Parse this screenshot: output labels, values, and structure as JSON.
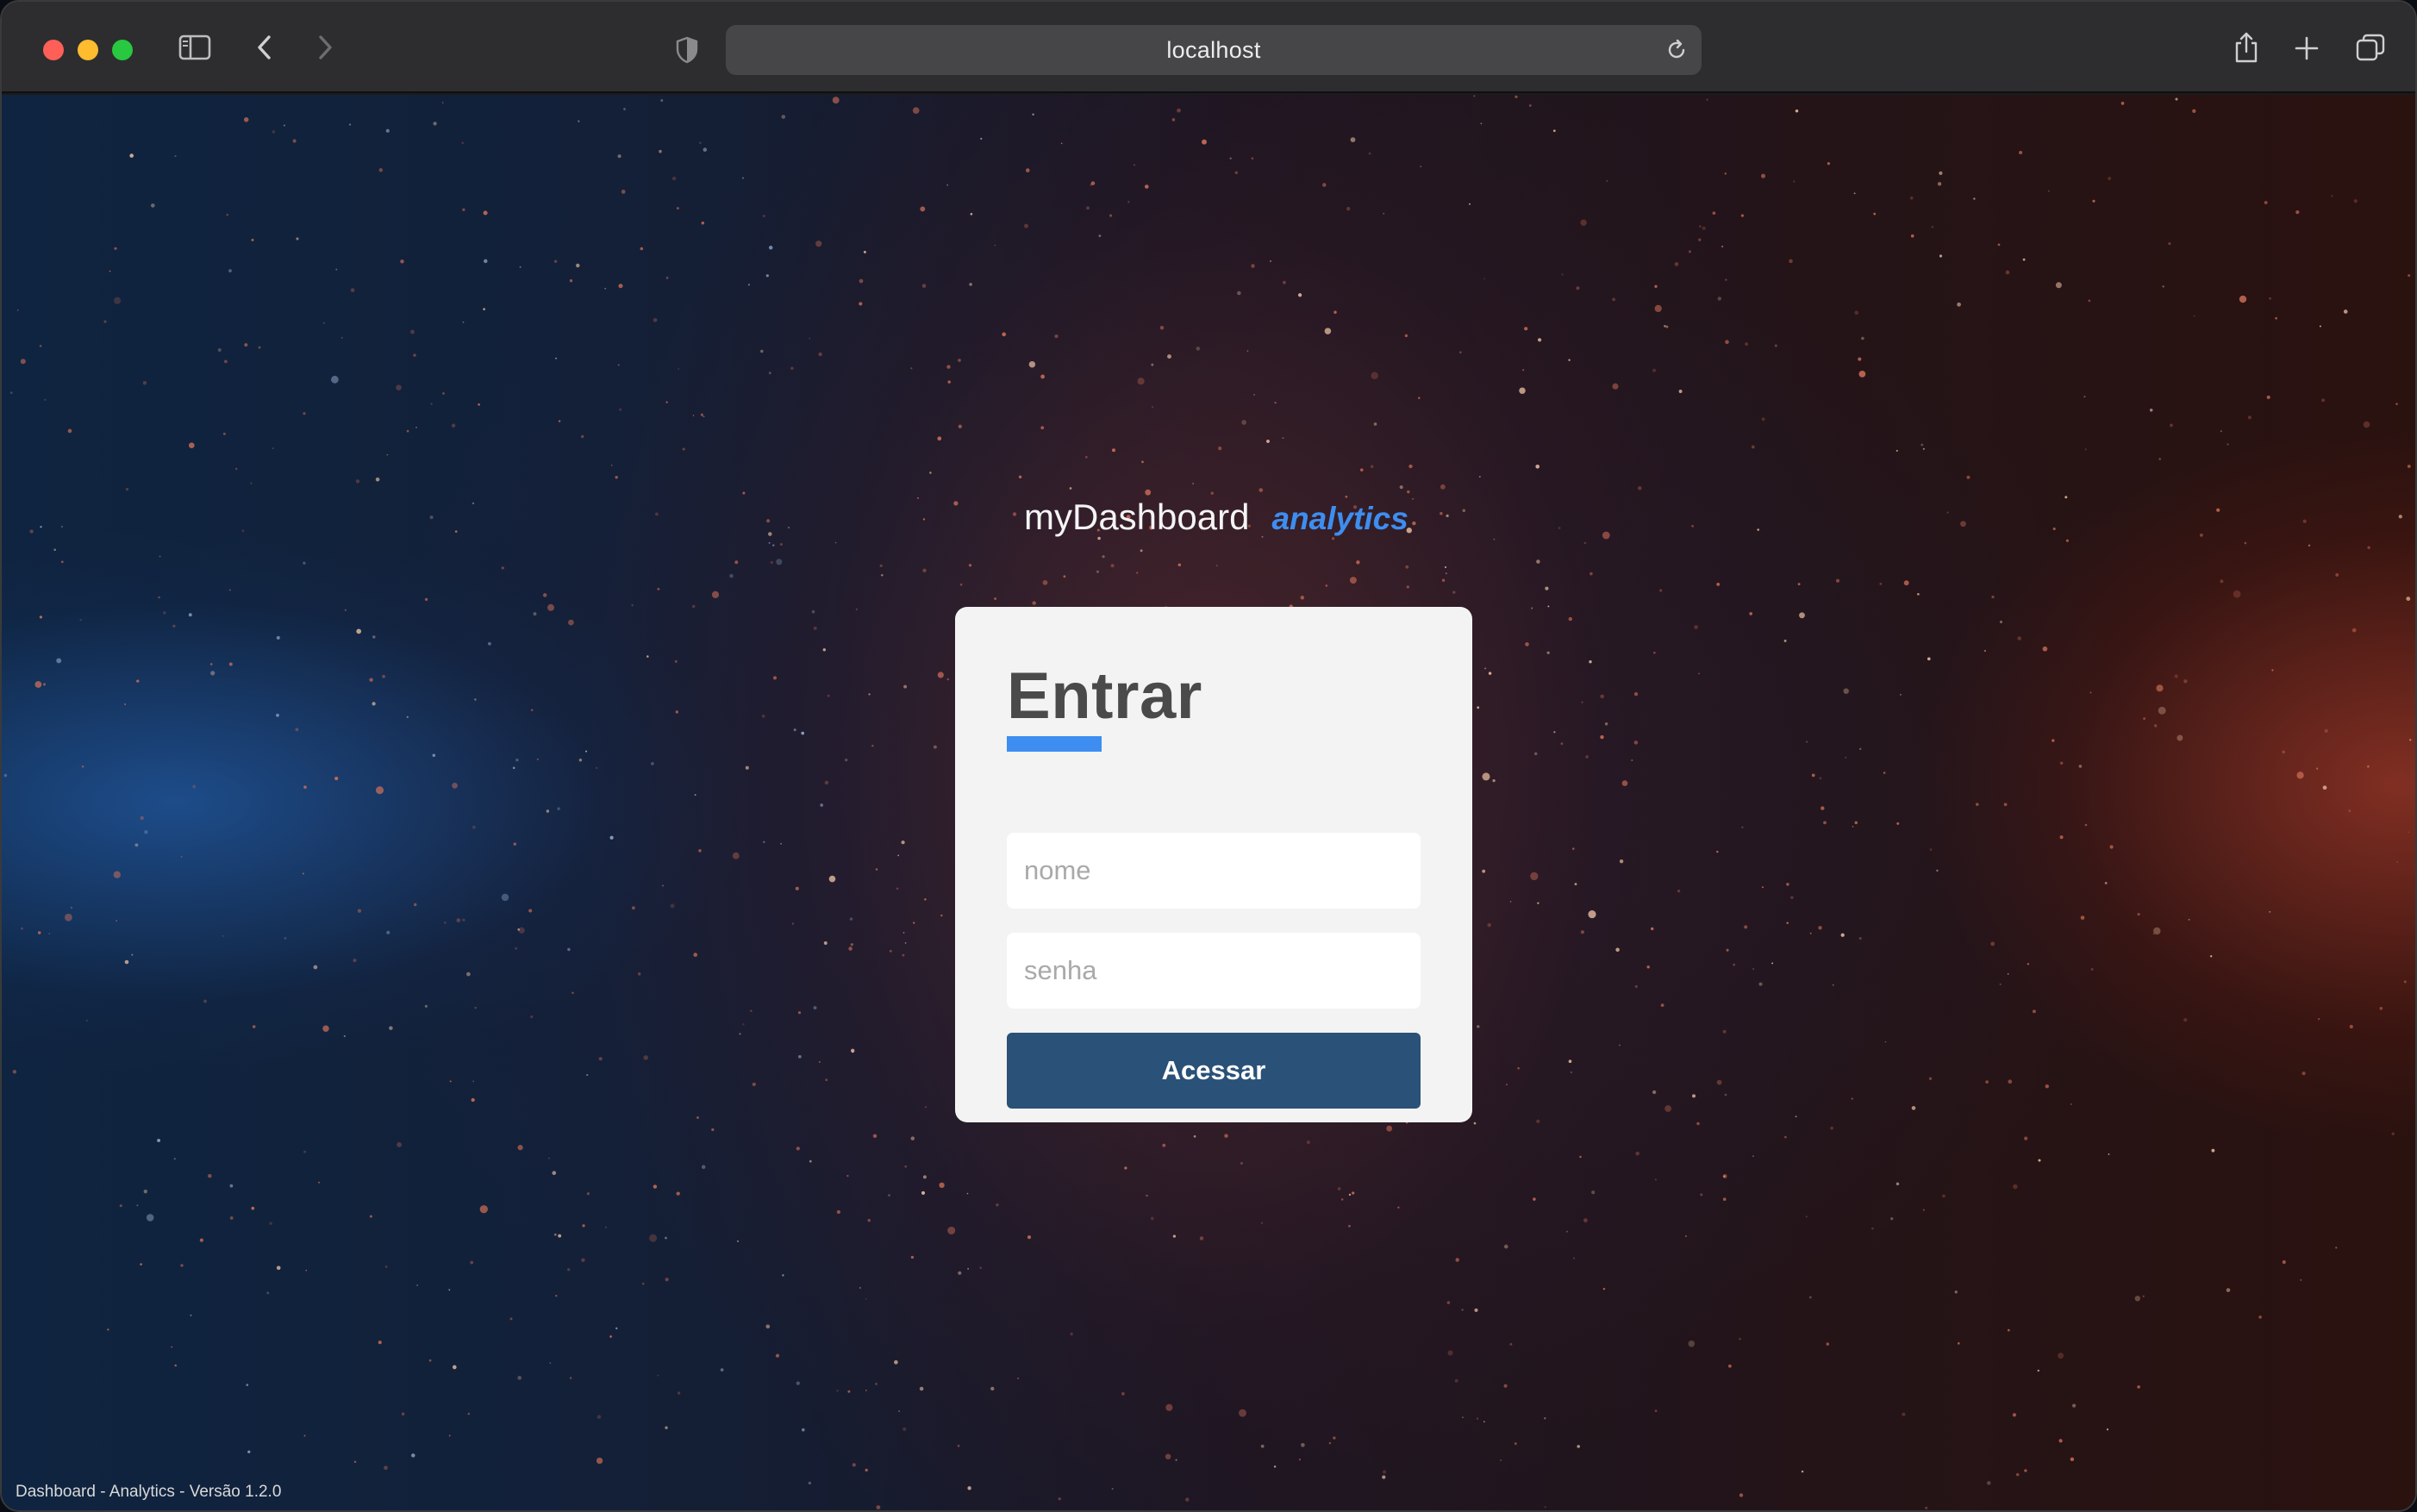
{
  "browser": {
    "url": "localhost",
    "icons": {
      "sidebar": "sidebar-icon",
      "back": "chevron-left-icon",
      "forward": "chevron-right-icon",
      "privacy": "shield-icon",
      "reload": "reload-icon",
      "share": "share-icon",
      "new_tab": "plus-icon",
      "tabs": "tab-overview-icon"
    }
  },
  "brand": {
    "name": "myDashboard",
    "sub": "analytics",
    "accent_color": "#3d8ef0"
  },
  "login": {
    "title": "Entrar",
    "username_placeholder": "nome",
    "password_placeholder": "senha",
    "submit_label": "Acessar",
    "button_color": "#2a5177"
  },
  "footer": {
    "version_text": "Dashboard - Analytics - Versão 1.2.0"
  }
}
